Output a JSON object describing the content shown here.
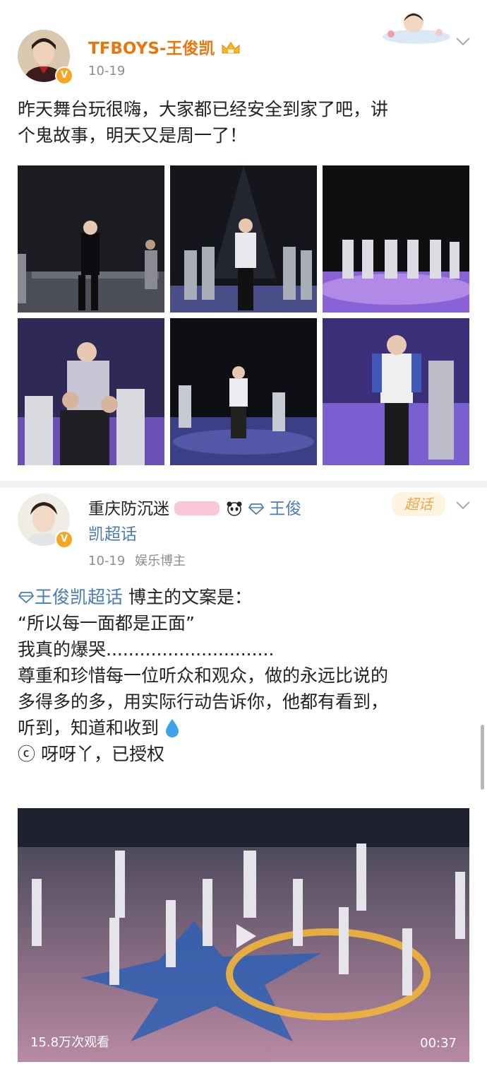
{
  "post1": {
    "username": "TFBOYS-王俊凯",
    "date": "10-19",
    "text_line1": "昨天舞台玩很嗨，大家都已经安全到家了吧，讲",
    "text_line2": "个鬼故事，明天又是周一了！"
  },
  "post2": {
    "username_line1": "重庆防沉迷",
    "username_topic1": "王俊",
    "username_line2": "凯超话",
    "date": "10-19",
    "role": "娱乐博主",
    "topic_badge": "超话",
    "topic_link": "王俊凯超话",
    "line1_rest": " 博主的文案是：",
    "line2": "“所以每一面都是正面”",
    "line3": "我真的爆哭..............................",
    "line4": "尊重和珍惜每一位听众和观众，做的永远比说的",
    "line5": "多得多的多，用实际行动告诉你，他都有看到，",
    "line6": "听到，知道和收到",
    "line7": "ⓒ 呀呀丫，已授权",
    "views": "15.8万次观看",
    "duration": "00:37"
  },
  "icons": {
    "verified": "verified-badge-icon",
    "chevron": "chevron-down-icon",
    "diamond": "diamond-icon",
    "droplet": "droplet-icon",
    "play": "play-icon"
  },
  "colors": {
    "link": "#4a7db5",
    "badge": "#f5a623",
    "stage_purple": "#7a4fc9"
  }
}
